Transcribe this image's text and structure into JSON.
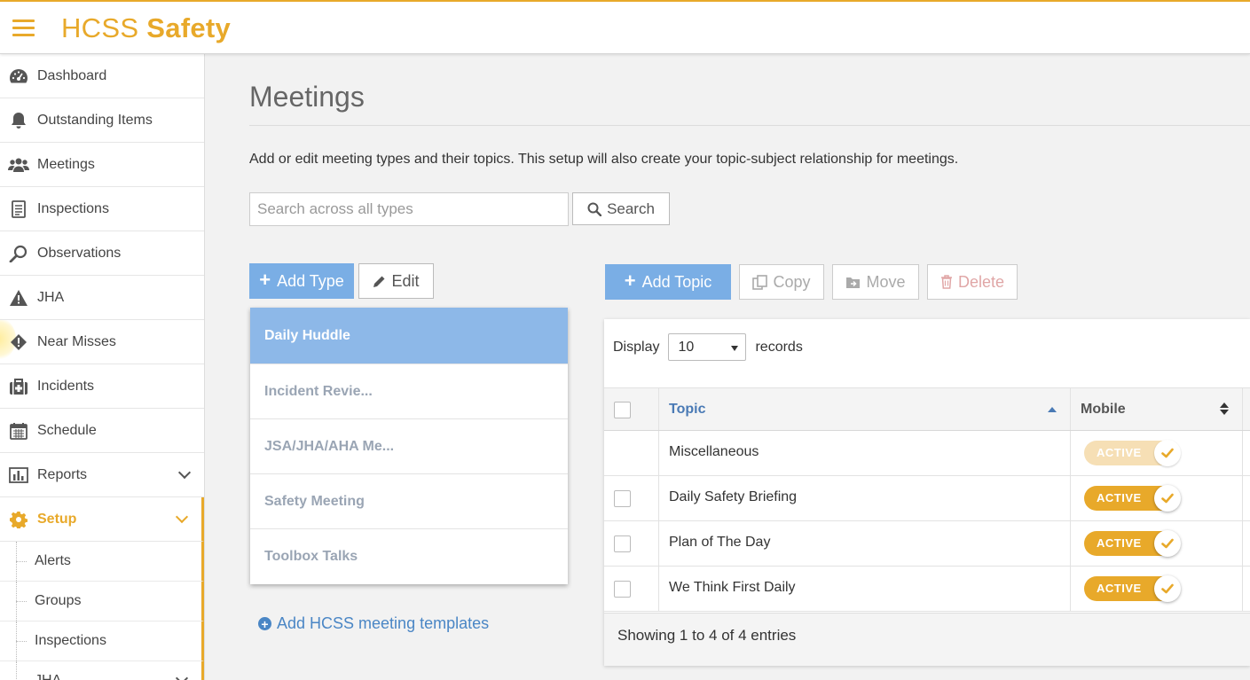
{
  "header": {
    "brand_light": "HCSS",
    "brand_bold": "Safety",
    "accent": "#e8a92a"
  },
  "sidebar": {
    "items": [
      {
        "label": "Dashboard",
        "icon": "dashboard-icon"
      },
      {
        "label": "Outstanding Items",
        "icon": "bell-icon"
      },
      {
        "label": "Meetings",
        "icon": "users-icon"
      },
      {
        "label": "Inspections",
        "icon": "clipboard-icon"
      },
      {
        "label": "Observations",
        "icon": "magnifier-icon"
      },
      {
        "label": "JHA",
        "icon": "warning-icon"
      },
      {
        "label": "Near Misses",
        "icon": "alert-diamond-icon"
      },
      {
        "label": "Incidents",
        "icon": "medkit-icon"
      },
      {
        "label": "Schedule",
        "icon": "calendar-icon"
      },
      {
        "label": "Reports",
        "icon": "bar-chart-icon"
      },
      {
        "label": "Setup",
        "icon": "gear-icon"
      }
    ],
    "sub_items": [
      {
        "label": "Alerts"
      },
      {
        "label": "Groups"
      },
      {
        "label": "Inspections"
      },
      {
        "label": "JHA"
      }
    ]
  },
  "main": {
    "title": "Meetings",
    "description": "Add or edit meeting types and their topics. This setup will also create your topic-subject relationship for meetings.",
    "search": {
      "placeholder": "Search across all types",
      "value": "",
      "button_label": "Search"
    },
    "type_buttons": {
      "add": "Add Type",
      "edit": "Edit"
    },
    "topic_buttons": {
      "add": "Add Topic",
      "copy": "Copy",
      "move": "Move",
      "delete": "Delete"
    },
    "types": [
      {
        "label": "Daily Huddle",
        "selected": true
      },
      {
        "label": "Incident Revie...",
        "selected": false
      },
      {
        "label": "JSA/JHA/AHA Me...",
        "selected": false
      },
      {
        "label": "Safety Meeting",
        "selected": false
      },
      {
        "label": "Toolbox Talks",
        "selected": false
      }
    ],
    "templates_link": "Add HCSS meeting templates",
    "table": {
      "display_label": "Display",
      "display_value": "10",
      "records_label": "records",
      "columns": {
        "topic": "Topic",
        "mobile": "Mobile"
      },
      "rows": [
        {
          "topic": "Miscellaneous",
          "status": "ACTIVE",
          "has_checkbox": false
        },
        {
          "topic": "Daily Safety Briefing",
          "status": "ACTIVE",
          "has_checkbox": true
        },
        {
          "topic": "Plan of The Day",
          "status": "ACTIVE",
          "has_checkbox": true
        },
        {
          "topic": "We Think First Daily",
          "status": "ACTIVE",
          "has_checkbox": true
        }
      ],
      "footer": "Showing 1 to 4 of 4 entries"
    }
  }
}
